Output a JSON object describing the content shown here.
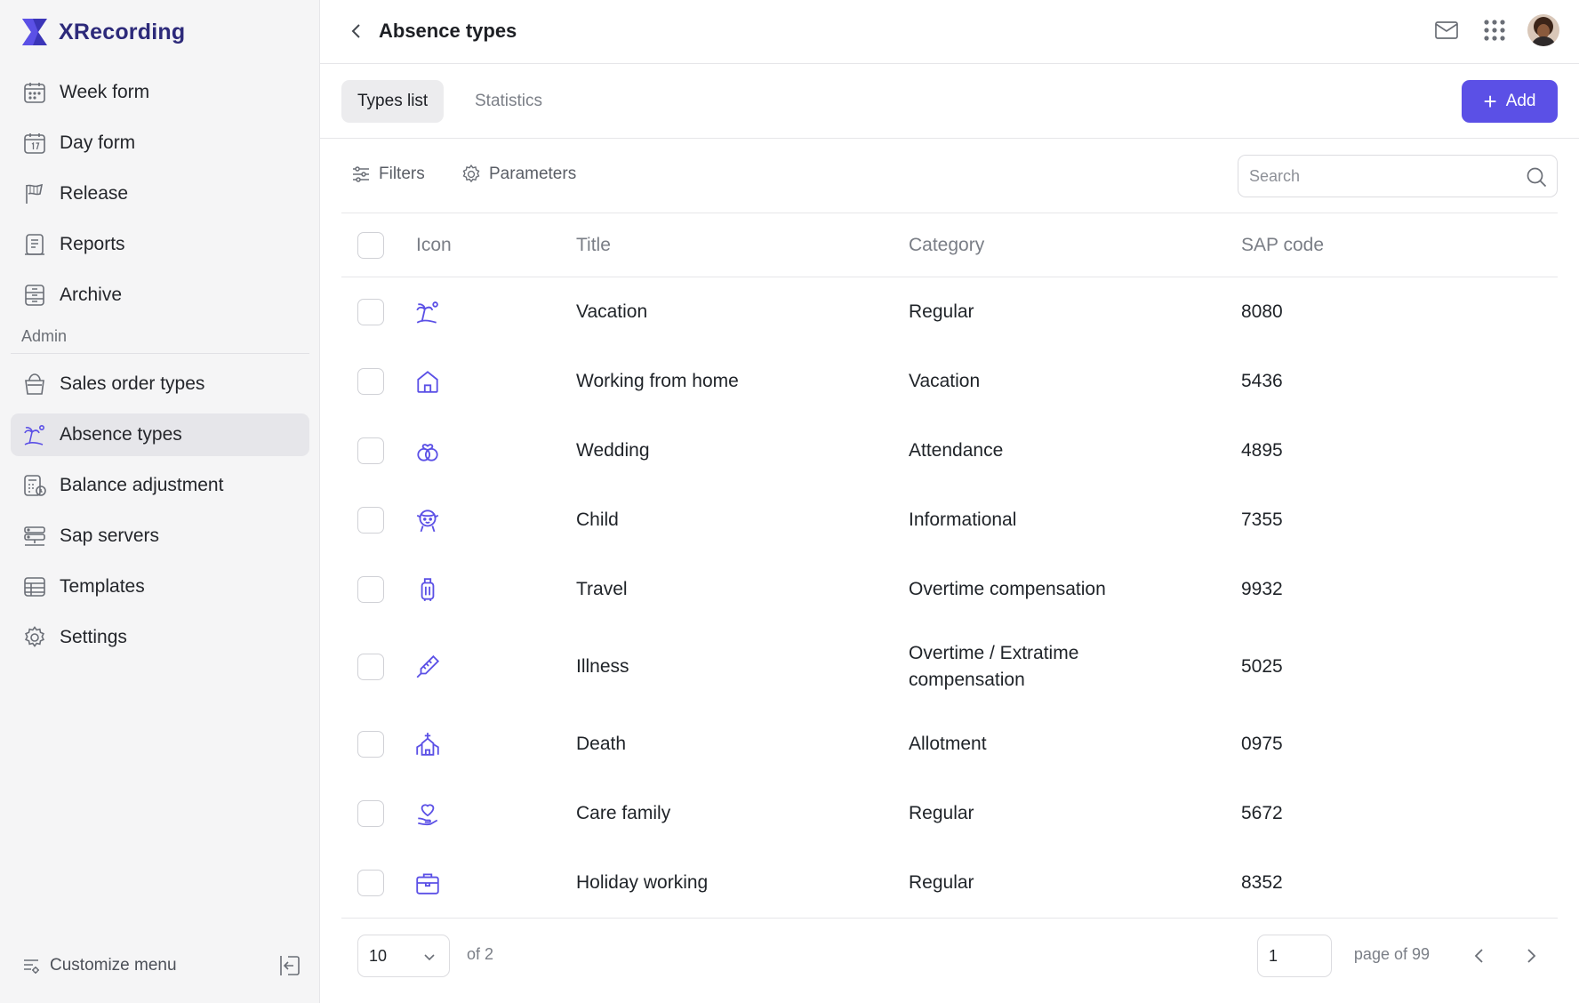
{
  "app": {
    "name": "XRecording"
  },
  "sidebar": {
    "items": [
      {
        "label": "Week form",
        "icon": "calendar-week-icon"
      },
      {
        "label": "Day form",
        "icon": "calendar-day-icon"
      },
      {
        "label": "Release",
        "icon": "flag-icon"
      },
      {
        "label": "Reports",
        "icon": "report-icon"
      },
      {
        "label": "Archive",
        "icon": "archive-icon"
      }
    ],
    "admin_section": "Admin",
    "admin_items": [
      {
        "label": "Sales order types",
        "icon": "cart-basket-icon"
      },
      {
        "label": "Absence types",
        "icon": "island-icon",
        "active": true
      },
      {
        "label": "Balance adjustment",
        "icon": "calculator-clock-icon"
      },
      {
        "label": "Sap servers",
        "icon": "server-icon"
      },
      {
        "label": "Templates",
        "icon": "table-icon"
      },
      {
        "label": "Settings",
        "icon": "gear-icon"
      }
    ],
    "customize_label": "Customize menu"
  },
  "header": {
    "title": "Absence types"
  },
  "tabs": [
    {
      "label": "Types list",
      "active": true
    },
    {
      "label": "Statistics",
      "active": false
    }
  ],
  "add_label": "Add",
  "toolbar": {
    "filters": "Filters",
    "parameters": "Parameters",
    "search_placeholder": "Search"
  },
  "table": {
    "columns": [
      "Icon",
      "Title",
      "Category",
      "SAP code"
    ],
    "rows": [
      {
        "icon": "island-icon",
        "title": "Vacation",
        "category": "Regular",
        "sap": "8080"
      },
      {
        "icon": "home-icon",
        "title": "Working from home",
        "category": "Vacation",
        "sap": "5436"
      },
      {
        "icon": "rings-icon",
        "title": "Wedding",
        "category": "Attendance",
        "sap": "4895"
      },
      {
        "icon": "child-icon",
        "title": "Child",
        "category": "Informational",
        "sap": "7355"
      },
      {
        "icon": "luggage-icon",
        "title": "Travel",
        "category": "Overtime compensation",
        "sap": "9932"
      },
      {
        "icon": "thermometer-icon",
        "title": "Illness",
        "category": "Overtime / Extratime compensation",
        "sap": "5025"
      },
      {
        "icon": "church-icon",
        "title": "Death",
        "category": "Allotment",
        "sap": "0975"
      },
      {
        "icon": "heart-hand-icon",
        "title": "Care family",
        "category": "Regular",
        "sap": "5672"
      },
      {
        "icon": "briefcase-icon",
        "title": "Holiday working",
        "category": "Regular",
        "sap": "8352"
      }
    ]
  },
  "pagination": {
    "page_size": "10",
    "of_total": "of 2",
    "page": "1",
    "page_of": "page of 99"
  },
  "colors": {
    "accent": "#5b50e6",
    "brand": "#2d2a7a",
    "icon": "#5b50e6"
  }
}
